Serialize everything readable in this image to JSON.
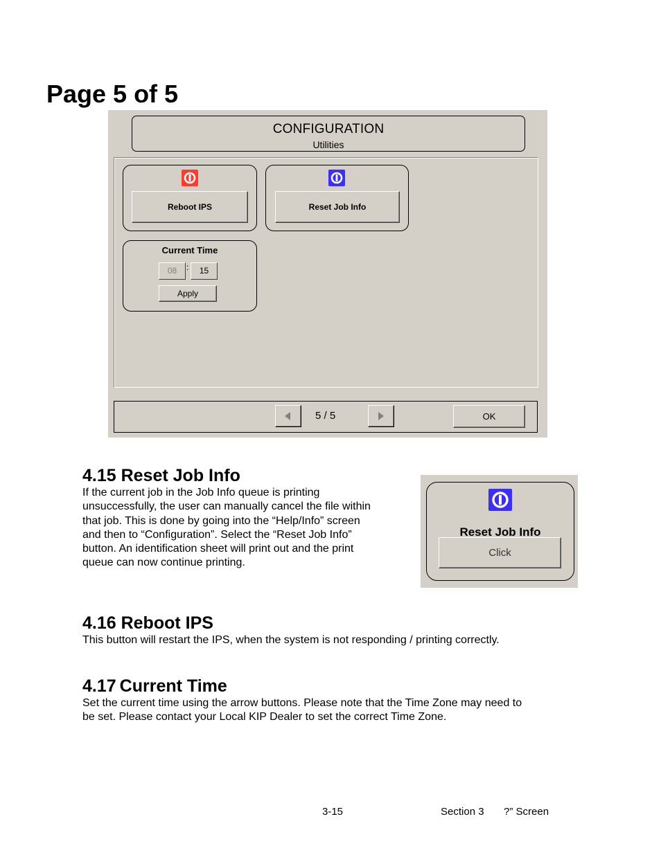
{
  "page_title": "Page 5 of 5",
  "screenshot": {
    "header": {
      "title": "CONFIGURATION",
      "subtitle": "Utilities"
    },
    "reboot": {
      "icon": "power-icon",
      "icon_color": "#ff3b2f",
      "label": "Reboot IPS"
    },
    "reset": {
      "icon": "power-icon",
      "icon_color": "#3a2fff",
      "label": "Reset Job Info"
    },
    "current_time": {
      "title": "Current Time",
      "hour": "08",
      "separator": ":",
      "minute": "15",
      "apply_label": "Apply"
    },
    "nav": {
      "prev_icon": "arrow-left-icon",
      "page_indicator": "5 / 5",
      "next_icon": "arrow-right-icon",
      "ok_label": "OK"
    }
  },
  "sections": [
    {
      "heading": "4.15 Reset Job Info",
      "lines": [
        "If the current job in the Job Info queue is printing",
        "unsuccessfully, the user can manually cancel the file within",
        "that job. This is done by going into the “Help/Info” screen",
        "and then to “Configuration”.  Select the “Reset Job Info”",
        "button. An identification sheet will print out and the print",
        "queue can now continue printing."
      ]
    },
    {
      "heading": "4.16 Reboot IPS",
      "lines": [
        "This button will restart the IPS, when the system is not responding / printing correctly."
      ]
    },
    {
      "heading": "4.17 Current Time",
      "lines": [
        "Set the current time using the arrow buttons. Please note that the Time Zone may need to",
        "be set. Please contact your Local KIP Dealer to set the correct Time Zone."
      ]
    }
  ],
  "mini_screenshot": {
    "icon": "power-icon",
    "icon_color": "#3a2fff",
    "title": "Reset Job Info",
    "button_label": "Click"
  },
  "footer": {
    "page_number": "3-15",
    "section": "Section 3",
    "section_name": "?” Screen"
  }
}
